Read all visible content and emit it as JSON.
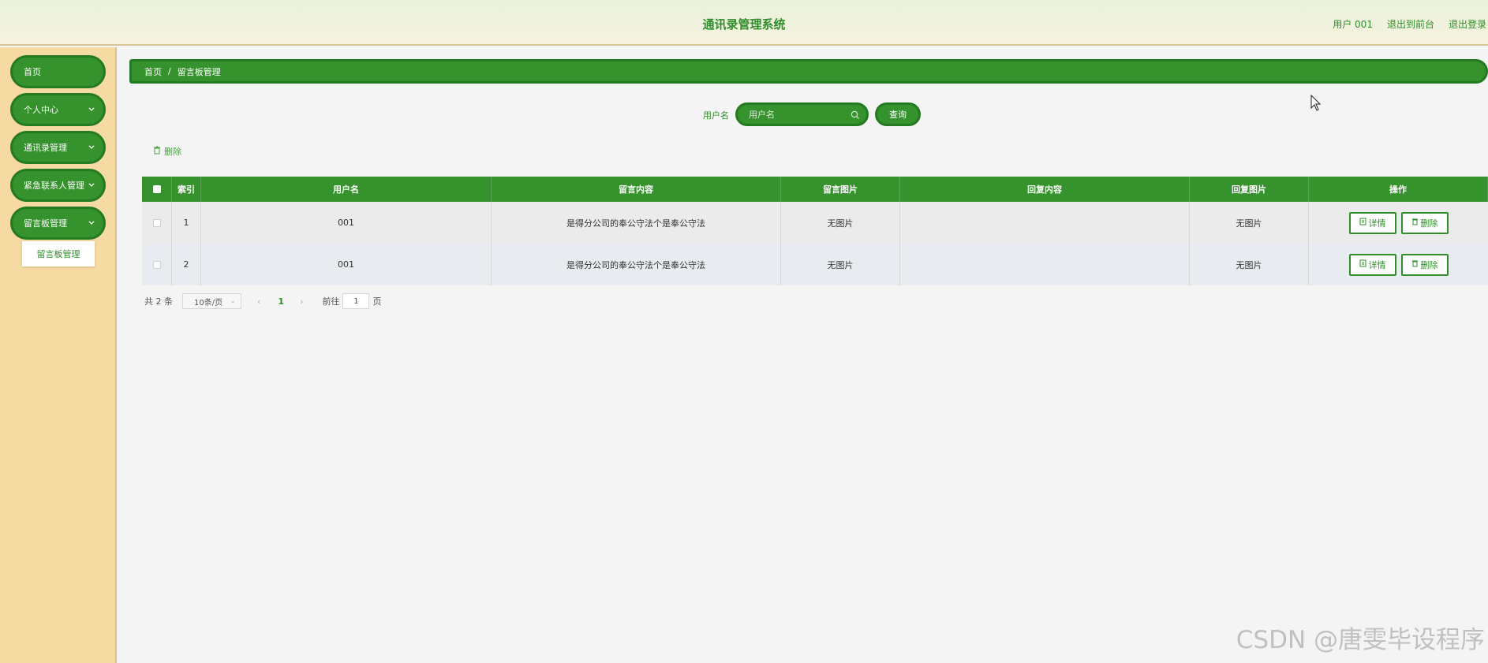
{
  "header": {
    "title": "通讯录管理系统",
    "user_label": "用户 001",
    "to_front": "退出到前台",
    "logout": "退出登录"
  },
  "sidebar": {
    "items": [
      {
        "label": "首页",
        "has_chevron": false
      },
      {
        "label": "个人中心",
        "has_chevron": true
      },
      {
        "label": "通讯录管理",
        "has_chevron": true
      },
      {
        "label": "紧急联系人管理",
        "has_chevron": true
      },
      {
        "label": "留言板管理",
        "has_chevron": true
      }
    ],
    "submenu": {
      "label": "留言板管理"
    }
  },
  "breadcrumb": {
    "home": "首页",
    "sep": "/",
    "current": "留言板管理"
  },
  "search": {
    "label": "用户名",
    "placeholder": "用户名",
    "button": "查询"
  },
  "toolbar": {
    "delete_label": "删除"
  },
  "table": {
    "headers": [
      "",
      "索引",
      "用户名",
      "留言内容",
      "留言图片",
      "回复内容",
      "回复图片",
      "操作"
    ],
    "rows": [
      {
        "index": "1",
        "username": "001",
        "content": "是得分公司的奉公守法个是奉公守法",
        "image": "无图片",
        "reply": "",
        "reply_image": "无图片"
      },
      {
        "index": "2",
        "username": "001",
        "content": "是得分公司的奉公守法个是奉公守法",
        "image": "无图片",
        "reply": "",
        "reply_image": "无图片"
      }
    ],
    "detail_label": "详情",
    "delete_label": "删除"
  },
  "pagination": {
    "total": "共 2 条",
    "page_size": "10条/页",
    "prev": "‹",
    "current_page": "1",
    "next": "›",
    "goto_label": "前往",
    "goto_value": "1",
    "goto_suffix": "页"
  },
  "watermark": "CSDN @唐雯毕设程序",
  "colors": {
    "primary": "#36922d",
    "primary_dark": "#247a20",
    "sidebar_bg": "#f5daa2",
    "content_bg": "#f4f4f4"
  }
}
